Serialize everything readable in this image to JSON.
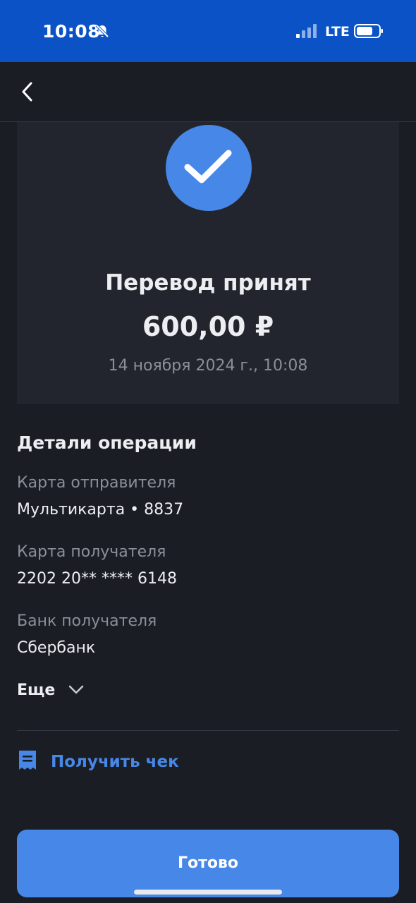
{
  "status_bar": {
    "time": "10:08",
    "network": "LTE",
    "bell_icon": "bell-muted-icon",
    "signal_icon": "signal-icon",
    "battery_icon": "battery-icon"
  },
  "header": {
    "back_icon": "chevron-left-icon"
  },
  "result": {
    "status_icon": "checkmark-icon",
    "title": "Перевод принят",
    "amount": "600,00 ₽",
    "datetime": "14 ноября 2024 г., 10:08"
  },
  "details": {
    "title": "Детали операции",
    "fields": [
      {
        "label": "Карта отправителя",
        "value": "Мультикарта • 8837"
      },
      {
        "label": "Карта получателя",
        "value": "2202 20** **** 6148"
      },
      {
        "label": "Банк получателя",
        "value": "Сбербанк"
      }
    ],
    "more_label": "Еще",
    "more_icon": "chevron-down-icon"
  },
  "receipt": {
    "label": "Получить чек",
    "icon": "receipt-icon"
  },
  "actions": {
    "done_label": "Готово"
  },
  "colors": {
    "status_bar": "#0a52c6",
    "background": "#1b1d24",
    "card": "#22252d",
    "accent": "#4787e8",
    "text_primary": "#eceef2",
    "text_secondary": "#8b8f99"
  }
}
